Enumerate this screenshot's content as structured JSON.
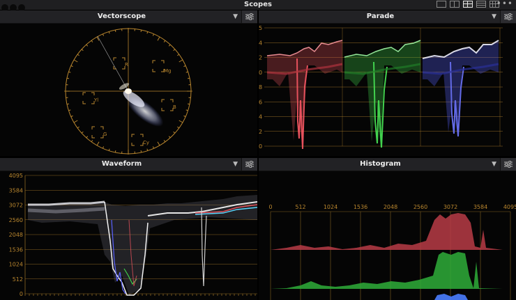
{
  "window": {
    "title": "Scopes",
    "layout_buttons": [
      "single-view-icon",
      "two-up-view-icon",
      "four-up-view-icon",
      "stacked-view-icon",
      "grid-view-icon"
    ],
    "active_layout": "four-up-view-icon",
    "more_glyph": "•••"
  },
  "colors": {
    "accent_graticule": "#b9862e",
    "panel_header": "#222225",
    "red": "#e0505a",
    "green": "#3fcf4a",
    "blue": "#5a62ff"
  },
  "panels": {
    "vectorscope": {
      "title": "Vectorscope",
      "targets": [
        "R",
        "Mg",
        "B",
        "Cy",
        "G",
        "Yl"
      ],
      "chevron": "⌄"
    },
    "parade": {
      "title": "Parade",
      "axis_labels": [
        "0",
        "2",
        "4",
        "6",
        "8",
        "0",
        "2",
        "4",
        "5"
      ]
    },
    "waveform": {
      "title": "Waveform",
      "axis_labels": [
        "0",
        "512",
        "1024",
        "1536",
        "2048",
        "2560",
        "3072",
        "3584",
        "4095"
      ]
    },
    "histogram": {
      "title": "Histogram",
      "axis_labels": [
        "0",
        "512",
        "1024",
        "1536",
        "2048",
        "2560",
        "3072",
        "3584",
        "4095"
      ]
    }
  }
}
